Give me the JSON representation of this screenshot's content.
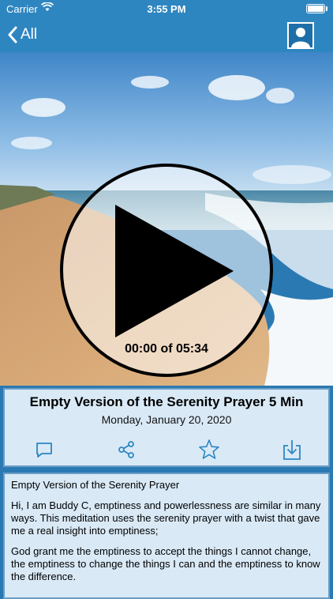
{
  "status": {
    "carrier": "Carrier",
    "time": "3:55 PM"
  },
  "nav": {
    "back_label": "All"
  },
  "player": {
    "timer": "00:00 of 05:34"
  },
  "episode": {
    "title": "Empty Version of the Serenity Prayer 5 Min",
    "date": "Monday, January 20, 2020"
  },
  "description": {
    "heading": "Empty Version of the Serenity Prayer",
    "p1": "Hi, I am Buddy C, emptiness and powerlessness are similar in many ways. This meditation uses the serenity prayer with a twist that gave me a real insight into emptiness;",
    "p2": "God grant me the emptiness to accept the things I cannot change, the emptiness to change the things I can and the emptiness to know the difference."
  },
  "icons": {
    "comment": "speech-bubble-icon",
    "share": "share-icon",
    "favorite": "star-icon",
    "download": "download-icon"
  },
  "colors": {
    "accent": "#2e86c1",
    "panel": "#d9e9f6",
    "icon": "#2d86c4"
  }
}
